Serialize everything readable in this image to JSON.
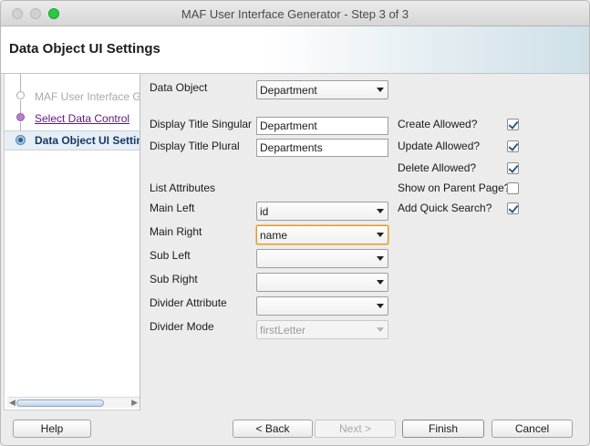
{
  "window": {
    "title": "MAF User Interface Generator - Step 3 of 3"
  },
  "header": {
    "title": "Data Object UI Settings"
  },
  "steps": [
    {
      "label": "MAF User Interface Ge",
      "state": "completed"
    },
    {
      "label": "Select Data Control",
      "state": "visited"
    },
    {
      "label": "Data Object UI Settin",
      "state": "current"
    }
  ],
  "form": {
    "data_object": {
      "label": "Data Object",
      "value": "Department"
    },
    "display_title_singular": {
      "label": "Display Title Singular",
      "value": "Department"
    },
    "display_title_plural": {
      "label": "Display Title Plural",
      "value": "Departments"
    },
    "list_attributes_label": "List Attributes",
    "main_left": {
      "label": "Main Left",
      "value": "id"
    },
    "main_right": {
      "label": "Main Right",
      "value": "name"
    },
    "sub_left": {
      "label": "Sub Left",
      "value": ""
    },
    "sub_right": {
      "label": "Sub Right",
      "value": ""
    },
    "divider_attribute": {
      "label": "Divider Attribute",
      "value": ""
    },
    "divider_mode": {
      "label": "Divider Mode",
      "value": "firstLetter",
      "enabled": false
    },
    "options": [
      {
        "label": "Create Allowed?",
        "checked": true
      },
      {
        "label": "Update Allowed?",
        "checked": true
      },
      {
        "label": "Delete Allowed?",
        "checked": true
      },
      {
        "label": "Show on Parent Page?",
        "checked": false
      },
      {
        "label": "Add Quick Search?",
        "checked": true
      }
    ]
  },
  "buttons": {
    "help": "Help",
    "back": "< Back",
    "next": "Next >",
    "finish": "Finish",
    "cancel": "Cancel"
  }
}
